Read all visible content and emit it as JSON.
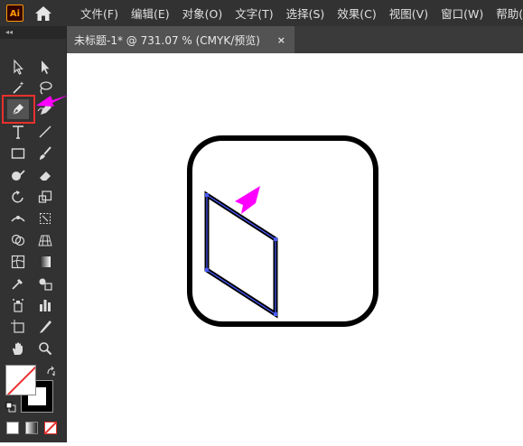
{
  "app": {
    "logo_text": "Ai",
    "home_icon": "home-icon"
  },
  "menu": {
    "items": [
      "文件(F)",
      "编辑(E)",
      "对象(O)",
      "文字(T)",
      "选择(S)",
      "效果(C)",
      "视图(V)",
      "窗口(W)",
      "帮助(H)"
    ]
  },
  "toolbar": {
    "collapse_label": "◂◂",
    "tools": [
      "selection-tool-icon",
      "direct-selection-tool-icon",
      "magic-wand-tool-icon",
      "lasso-tool-icon",
      "pen-tool-icon",
      "curvature-tool-icon",
      "type-tool-icon",
      "line-segment-tool-icon",
      "rectangle-tool-icon",
      "paintbrush-tool-icon",
      "shaper-tool-icon",
      "eraser-tool-icon",
      "rotate-tool-icon",
      "scale-tool-icon",
      "width-tool-icon",
      "free-transform-tool-icon",
      "shape-builder-tool-icon",
      "perspective-grid-tool-icon",
      "mesh-tool-icon",
      "gradient-tool-icon",
      "eyedropper-tool-icon",
      "blend-tool-icon",
      "symbol-sprayer-tool-icon",
      "column-graph-tool-icon",
      "artboard-tool-icon",
      "slice-tool-icon",
      "hand-tool-icon",
      "zoom-tool-icon"
    ],
    "selected_tool": "pen-tool-icon",
    "highlight_color": "#e8302d"
  },
  "document": {
    "tab_title": "未标题-1* @ 731.07 % (CMYK/预览)",
    "close_label": "×"
  },
  "colors": {
    "ui_dark": "#323232",
    "path_selection": "#4a5bff",
    "annotation_arrow": "#ff00ff",
    "stroke": "#000000"
  }
}
